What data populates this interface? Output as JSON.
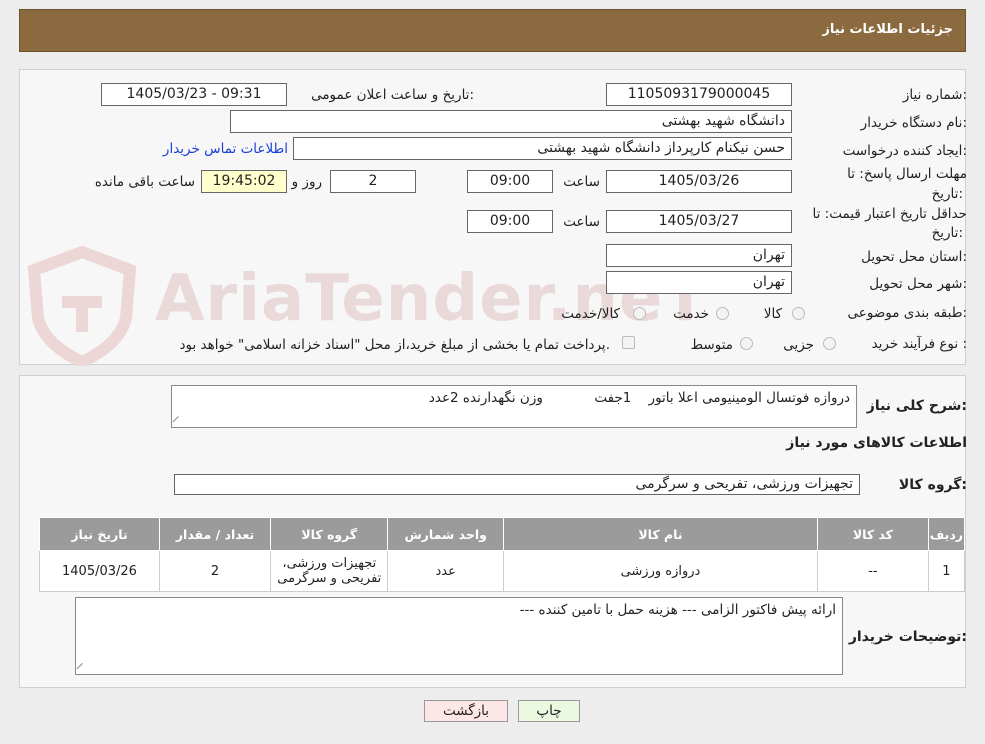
{
  "header": {
    "title": "جزئیات اطلاعات نیاز"
  },
  "watermark": {
    "text": "AriaTender.neT"
  },
  "fields": {
    "need_number_label": "شماره نیاز:",
    "need_number": "1105093179000045",
    "announce_label": "تاریخ و ساعت اعلان عمومی:",
    "announce_value": "1405/03/23 - 09:31",
    "buyer_org_label": "نام دستگاه خریدار:",
    "buyer_org": "دانشگاه شهید بهشتی",
    "creator_label": "ایجاد کننده درخواست:",
    "creator": "حسن نیکنام کارپرداز دانشگاه شهید بهشتی",
    "contact_link": "اطلاعات تماس خریدار",
    "reply_deadline_label_1": "مهلت ارسال پاسخ: تا",
    "reply_deadline_label_2": "تاریخ:",
    "reply_date": "1405/03/26",
    "time_label": "ساعت",
    "reply_time": "09:00",
    "days_value": "2",
    "days_label": "روز و",
    "remaining_time": "19:45:02",
    "remaining_label": "ساعت باقی مانده",
    "price_validity_label_1": "حداقل تاریخ اعتبار قیمت: تا",
    "price_validity_label_2": "تاریخ:",
    "price_validity_date": "1405/03/27",
    "price_validity_time": "09:00",
    "province_label": "استان محل تحویل:",
    "province": "تهران",
    "city_label": "شهر محل تحویل:",
    "city": "تهران",
    "category_label": "طبقه بندی موضوعی:",
    "category_options": [
      "کالا",
      "خدمت",
      "کالا/خدمت"
    ],
    "process_label": "نوع فرآیند خرید :",
    "process_options": [
      "جزیی",
      "متوسط"
    ],
    "payment_note": "پرداخت تمام یا بخشی از مبلغ خرید،از محل \"اسناد خزانه اسلامی\" خواهد بود."
  },
  "summary": {
    "label": "شرح کلی نیاز:",
    "text": "دروازه فوتسال الومینیومی اعلا باتور    1جفت            وزن نگهدارنده 2عدد"
  },
  "goods_info_title": "اطلاعات کالاهای مورد نیاز",
  "goods_group": {
    "label": "گروه کالا:",
    "value": "تجهیزات ورزشی، تفریحی و سرگرمی"
  },
  "table": {
    "headers": [
      "ردیف",
      "کد کالا",
      "نام کالا",
      "واحد شمارش",
      "گروه کالا",
      "تعداد / مقدار",
      "تاریخ نیاز"
    ],
    "rows": [
      [
        "1",
        "--",
        "دروازه ورزشی",
        "عدد",
        "تجهیزات ورزشی، تفریحی و سرگرمی",
        "2",
        "1405/03/26"
      ]
    ]
  },
  "buyer_notes": {
    "label": "توضیحات خریدار:",
    "text": "ارائه پیش فاکتور الزامی --- هزینه حمل با تامین کننده ---"
  },
  "buttons": {
    "print": "چاپ",
    "back": "بازگشت"
  },
  "colors": {
    "header_bg": "#8a6a3e",
    "table_header": "#9b9b9b",
    "remaining_bg": "#ffffcc",
    "print_bg": "#eaf9e0",
    "back_bg": "#fde6e6"
  }
}
